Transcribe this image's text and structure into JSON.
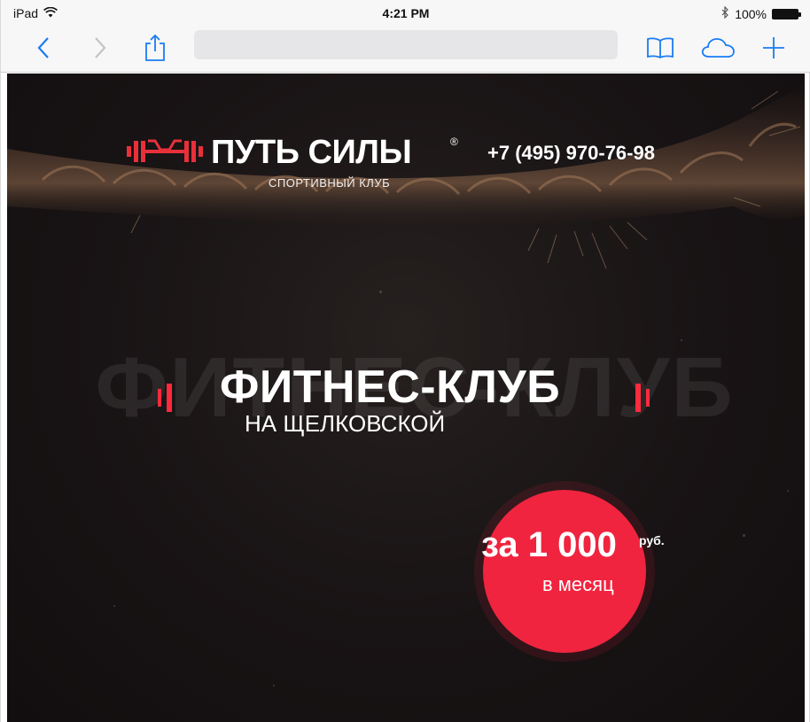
{
  "status_bar": {
    "device": "iPad",
    "time": "4:21 PM",
    "battery": "100%"
  },
  "browser": {
    "icons": [
      "back-icon",
      "forward-icon",
      "share-icon",
      "bookmarks-icon",
      "cloud-tabs-icon",
      "new-tab-icon"
    ]
  },
  "site": {
    "logo": {
      "name": "ПУТЬ СИЛЫ",
      "reg": "®",
      "subtitle": "СПОРТИВНЫЙ КЛУБ"
    },
    "phone": "+7 (495) 970-76-98",
    "hero": {
      "background_word": "ФИТНЕС-КЛУБ",
      "title": "ФИТНЕС-КЛУБ",
      "subtitle": "НА ЩЕЛКОВСКОЙ"
    },
    "offer": {
      "price": "за 1 000",
      "currency": "руб.",
      "period": "в месяц"
    }
  },
  "colors": {
    "accent": "#f0243f",
    "ios_blue": "#1a7cf4",
    "page_bg": "#161213"
  }
}
